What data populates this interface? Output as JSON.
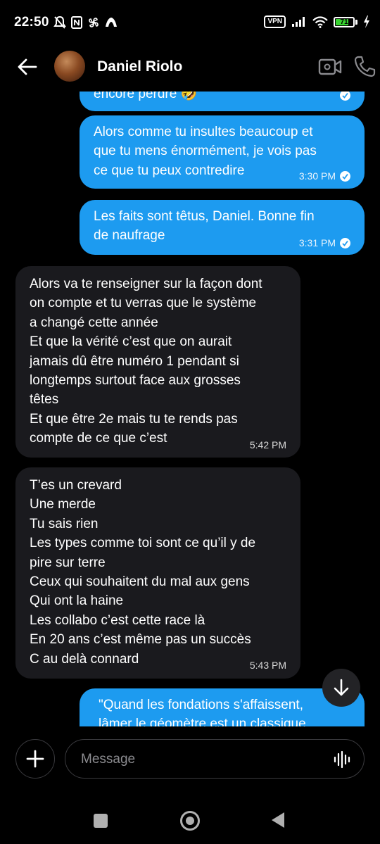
{
  "status_bar": {
    "time": "22:50",
    "vpn": "VPN",
    "battery": "71",
    "battery_level": 0.71,
    "icons": [
      "mute-bell-icon",
      "nfc-icon",
      "pinwheel-icon",
      "app-icon",
      "signal-icon",
      "wifi-icon",
      "charging-bolt-icon"
    ]
  },
  "header": {
    "contact_name": "Daniel Riolo",
    "back_icon": "arrow-left-icon",
    "video_icon": "video-camera-icon",
    "call_icon": "phone-icon"
  },
  "messages": [
    {
      "direction": "out",
      "text": "encore perdre 🤣",
      "time": ""
    },
    {
      "direction": "out",
      "text": "Alors comme tu insultes beaucoup et\nque tu mens énormément, je vois pas\nce que tu peux contredire",
      "time": "3:30 PM"
    },
    {
      "direction": "out",
      "text": "Les faits sont têtus, Daniel. Bonne fin\nde naufrage",
      "time": "3:31 PM"
    },
    {
      "direction": "in",
      "text": "Alors va te renseigner sur la façon dont\non compte et tu verras que le système\na changé cette année\nEt que la vérité c’est que on aurait\njamais dû être numéro 1 pendant si\nlongtemps surtout face aux grosses\ntêtes\nEt que être 2e mais tu te rends pas\ncompte de ce que c’est",
      "time": "5:42 PM"
    },
    {
      "direction": "in",
      "text": "T’es un crevard\nUne merde\nTu sais rien\nLes types comme toi sont ce qu’il y de\npire sur terre\nCeux qui souhaitent du mal aux gens\nQui ont la haine\nLes collabo c’est cette race là\nEn 20 ans c’est même pas un succès\nC au delà connard",
      "time": "5:43 PM"
    },
    {
      "direction": "out",
      "text": "\"Quand les fondations s'affaissent,\nlâmer le géomètre est un classique",
      "time": ""
    }
  ],
  "composer": {
    "placeholder": "Message",
    "add_icon": "plus-icon",
    "voice_icon": "voice-wave-icon"
  },
  "scroll_down_icon": "arrow-down-icon",
  "nav": [
    "recent-apps-icon",
    "home-icon",
    "back-triangle-icon"
  ]
}
